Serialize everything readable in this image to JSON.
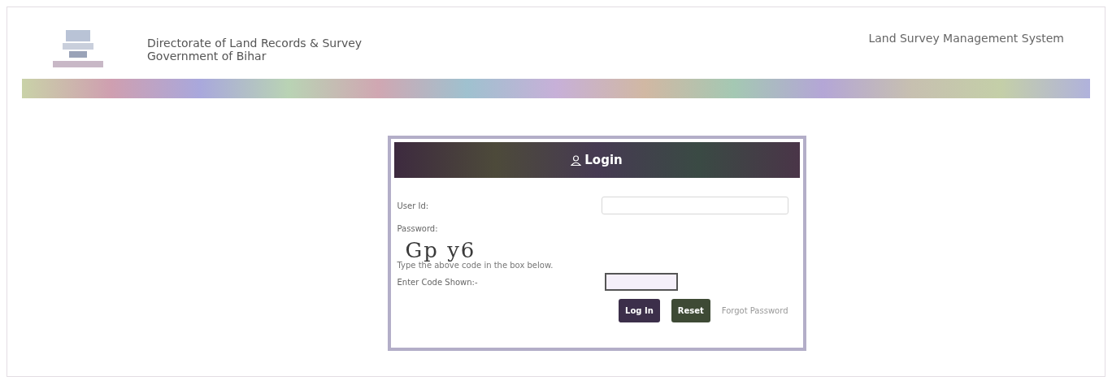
{
  "header": {
    "org_line_1": "Directorate of Land Records & Survey",
    "org_line_2": "Government of Bihar",
    "system_title": "Land Survey Management System"
  },
  "login": {
    "title": "Login",
    "fields": [
      {
        "label": "User Id:",
        "kind": "text"
      },
      {
        "label": "Password:",
        "kind": "hidden"
      }
    ],
    "captcha_text": "Gp y6",
    "captcha_hint": "Type the above code in the box below.",
    "code_label": "Enter Code Shown:-",
    "buttons": [
      "Log In",
      "Reset"
    ],
    "forgot_link": "Forgot Password"
  }
}
